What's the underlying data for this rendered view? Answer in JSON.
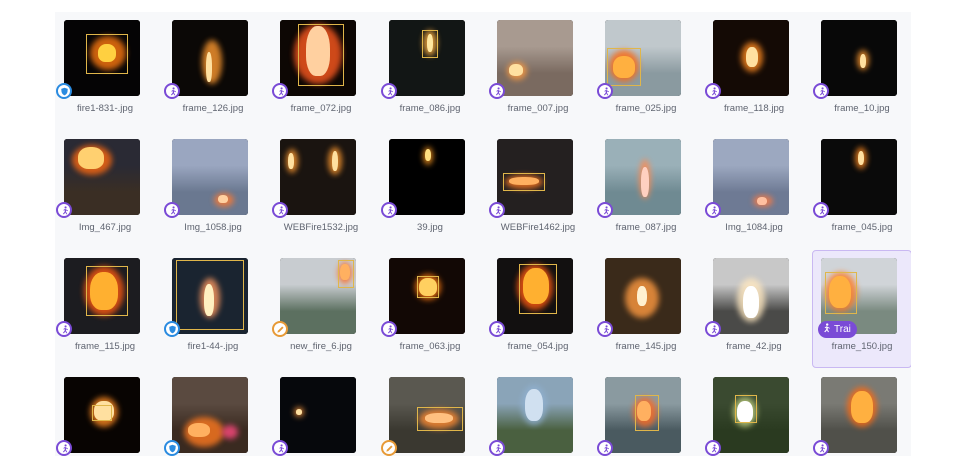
{
  "gallery": {
    "items": [
      {
        "file": "fire1-831-.jpg",
        "tag": "shield-icon",
        "tag_color": "#2a8be0"
      },
      {
        "file": "frame_126.jpg",
        "tag": "run-icon",
        "tag_color": "#7a4bd6"
      },
      {
        "file": "frame_072.jpg",
        "tag": "run-icon",
        "tag_color": "#7a4bd6"
      },
      {
        "file": "frame_086.jpg",
        "tag": "run-icon",
        "tag_color": "#7a4bd6"
      },
      {
        "file": "frame_007.jpg",
        "tag": "run-icon",
        "tag_color": "#7a4bd6"
      },
      {
        "file": "frame_025.jpg",
        "tag": "run-icon",
        "tag_color": "#7a4bd6"
      },
      {
        "file": "frame_118.jpg",
        "tag": "run-icon",
        "tag_color": "#7a4bd6"
      },
      {
        "file": "frame_10.jpg",
        "tag": "run-icon",
        "tag_color": "#7a4bd6"
      },
      {
        "file": "Img_467.jpg",
        "tag": "run-icon",
        "tag_color": "#7a4bd6"
      },
      {
        "file": "Img_1058.jpg",
        "tag": "run-icon",
        "tag_color": "#7a4bd6"
      },
      {
        "file": "WEBFire1532.jpg",
        "tag": "run-icon",
        "tag_color": "#7a4bd6"
      },
      {
        "file": "39.jpg",
        "tag": "run-icon",
        "tag_color": "#7a4bd6"
      },
      {
        "file": "WEBFire1462.jpg",
        "tag": "run-icon",
        "tag_color": "#7a4bd6"
      },
      {
        "file": "frame_087.jpg",
        "tag": "run-icon",
        "tag_color": "#7a4bd6"
      },
      {
        "file": "Img_1084.jpg",
        "tag": "run-icon",
        "tag_color": "#7a4bd6"
      },
      {
        "file": "frame_045.jpg",
        "tag": "run-icon",
        "tag_color": "#7a4bd6"
      },
      {
        "file": "frame_115.jpg",
        "tag": "run-icon",
        "tag_color": "#7a4bd6"
      },
      {
        "file": "fire1-44-.jpg",
        "tag": "shield-icon",
        "tag_color": "#2a8be0"
      },
      {
        "file": "new_fire_6.jpg",
        "tag": "pencil-icon",
        "tag_color": "#e79a37"
      },
      {
        "file": "frame_063.jpg",
        "tag": "run-icon",
        "tag_color": "#7a4bd6"
      },
      {
        "file": "frame_054.jpg",
        "tag": "run-icon",
        "tag_color": "#7a4bd6"
      },
      {
        "file": "frame_145.jpg",
        "tag": "run-icon",
        "tag_color": "#7a4bd6"
      },
      {
        "file": "frame_42.jpg",
        "tag": "run-icon",
        "tag_color": "#7a4bd6"
      },
      {
        "file": "frame_150.jpg",
        "tag": "run-icon",
        "tag_color": "#7a4bd6",
        "selected": true,
        "pill_label": "Trai"
      },
      {
        "file": "",
        "tag": "run-icon",
        "tag_color": "#7a4bd6"
      },
      {
        "file": "",
        "tag": "shield-icon",
        "tag_color": "#2a8be0"
      },
      {
        "file": "",
        "tag": "run-icon",
        "tag_color": "#7a4bd6"
      },
      {
        "file": "",
        "tag": "pencil-icon",
        "tag_color": "#e79a37"
      },
      {
        "file": "",
        "tag": "run-icon",
        "tag_color": "#7a4bd6"
      },
      {
        "file": "",
        "tag": "run-icon",
        "tag_color": "#7a4bd6"
      },
      {
        "file": "",
        "tag": "run-icon",
        "tag_color": "#7a4bd6"
      },
      {
        "file": "",
        "tag": "run-icon",
        "tag_color": "#7a4bd6"
      }
    ]
  }
}
